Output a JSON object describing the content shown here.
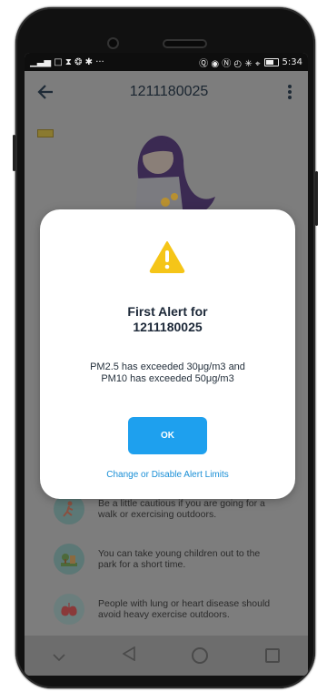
{
  "statusbar": {
    "left_icons": "▁▃▅ □ ⧗ ❂ ✱ ···",
    "right_icons": "Ⓠ ◉ Ⓝ ◴ ✳ ⌖",
    "time": "5:34"
  },
  "appbar": {
    "title": "1211180025"
  },
  "tips": [
    {
      "text": "Be a little cautious if you are going for a walk or exercising outdoors.",
      "icon": "runner-icon"
    },
    {
      "text": "You can take young children out to the park for a short time.",
      "icon": "park-icon"
    },
    {
      "text": "People with lung or heart disease should avoid heavy exercise outdoors.",
      "icon": "lungs-icon"
    }
  ],
  "dialog": {
    "title_line1": "First Alert for",
    "title_line2": "1211180025",
    "message_line1": "PM2.5 has exceeded 30μg/m3 and",
    "message_line2": "PM10 has exceeded 50μg/m3",
    "ok_label": "OK",
    "link_label": "Change or Disable Alert Limits",
    "accent_color": "#1ea0ee",
    "warning_color": "#f5c518"
  }
}
